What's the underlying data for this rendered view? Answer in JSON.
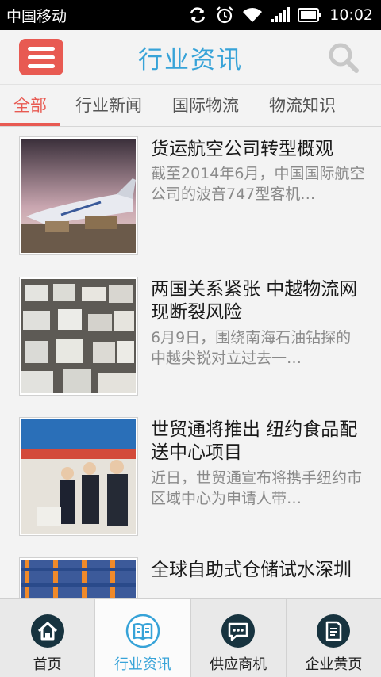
{
  "status_bar": {
    "carrier": "中国移动",
    "time": "10:02"
  },
  "header": {
    "title": "行业资讯"
  },
  "tabs": [
    {
      "label": "全部"
    },
    {
      "label": "行业新闻"
    },
    {
      "label": "国际物流"
    },
    {
      "label": "物流知识"
    }
  ],
  "articles": [
    {
      "title": "货运航空公司转型概观",
      "summary": "截至2014年6月，中国国际航空公司的波音747型客机…"
    },
    {
      "title": "两国关系紧张 中越物流网现断裂风险",
      "summary": "6月9日，围绕南海石油钻探的中越尖锐对立过去一…"
    },
    {
      "title": "世贸通将推出 纽约食品配送中心项目",
      "summary": "近日，世贸通宣布将携手纽约市区域中心为申请人带…"
    },
    {
      "title": "全球自助式仓储试水深圳",
      "summary": ""
    }
  ],
  "bottom_nav": [
    {
      "label": "首页",
      "icon": "home-icon"
    },
    {
      "label": "行业资讯",
      "icon": "book-icon"
    },
    {
      "label": "供应商机",
      "icon": "chat-icon"
    },
    {
      "label": "企业黄页",
      "icon": "document-icon"
    }
  ],
  "colors": {
    "accent": "#37a3d8",
    "menu": "#e85a52",
    "nav_icon": "#17333f"
  }
}
